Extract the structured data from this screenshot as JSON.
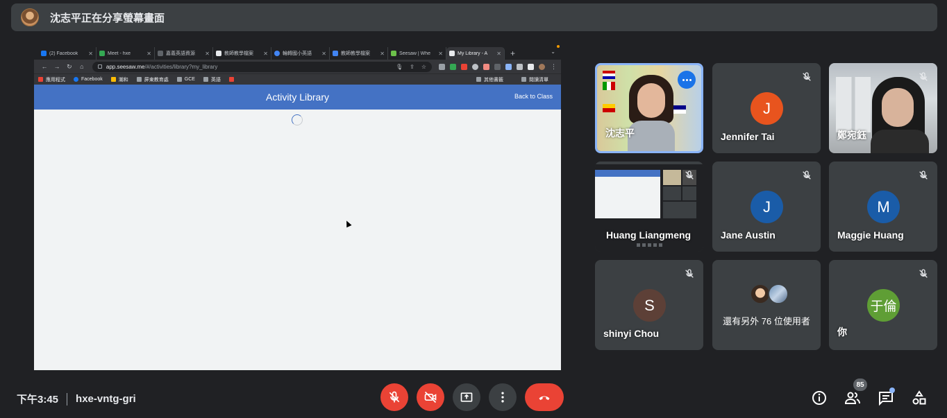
{
  "banner": {
    "text": "沈志平正在分享螢幕畫面",
    "avatar_icon": "presenter-avatar"
  },
  "browser": {
    "tabs": [
      {
        "label": "(2) Facebook",
        "color": "#1877f2"
      },
      {
        "label": "Meet - hxe",
        "color": "#34a853"
      },
      {
        "label": "嘉義英語資源",
        "color": "#5f6368"
      },
      {
        "label": "教師教學檔案",
        "color": "#e8eaed"
      },
      {
        "label": "輪轉國小英語",
        "color": "#4285f4"
      },
      {
        "label": "教師教學檔案",
        "color": "#4285f4"
      },
      {
        "label": "Seesaw | Whe",
        "color": "#6cc04a"
      },
      {
        "label": "My Library - A",
        "color": "#e8eaed"
      }
    ],
    "url_host": "app.seesaw.me",
    "url_path": "/#/activities/library?my_library",
    "bookmarks": [
      {
        "label": "應用程式",
        "color": "#ea4335"
      },
      {
        "label": "Facebook",
        "color": "#1877f2"
      },
      {
        "label": "潮和",
        "color": "#fbbc04"
      },
      {
        "label": "屏東教育處",
        "color": "#9aa0a6"
      },
      {
        "label": "GCE",
        "color": "#9aa0a6"
      },
      {
        "label": "英語",
        "color": "#9aa0a6"
      },
      {
        "label": "",
        "color": "#ea4335"
      }
    ],
    "bookmarks_right": [
      "其他書籤",
      "閱讀清單"
    ]
  },
  "app": {
    "title": "Activity Library",
    "back_label": "Back to Class"
  },
  "participants": [
    {
      "name": "沈志平",
      "type": "video"
    },
    {
      "name": "Jennifer Tai",
      "initial": "J",
      "color": "#e8541e"
    },
    {
      "name": "鄭宛鈺",
      "type": "video"
    },
    {
      "name": "Huang Liangmeng",
      "type": "screen"
    },
    {
      "name": "Jane Austin",
      "initial": "J",
      "color": "#1a5ca8"
    },
    {
      "name": "Maggie Huang",
      "initial": "M",
      "color": "#1a5ca8"
    },
    {
      "name": "shinyi Chou",
      "initial": "S",
      "color": "#5d4037"
    },
    {
      "name": "還有另外 76 位使用者",
      "type": "others"
    },
    {
      "name": "你",
      "initial": "于倫",
      "color": "#5f9e35"
    }
  ],
  "bottom": {
    "time": "下午3:45",
    "meeting_code": "hxe-vntg-gri",
    "participant_count": "85"
  },
  "colors": {
    "accent": "#8ab4f8",
    "end_call": "#ea4335",
    "seesaw_header": "#4472c4"
  }
}
